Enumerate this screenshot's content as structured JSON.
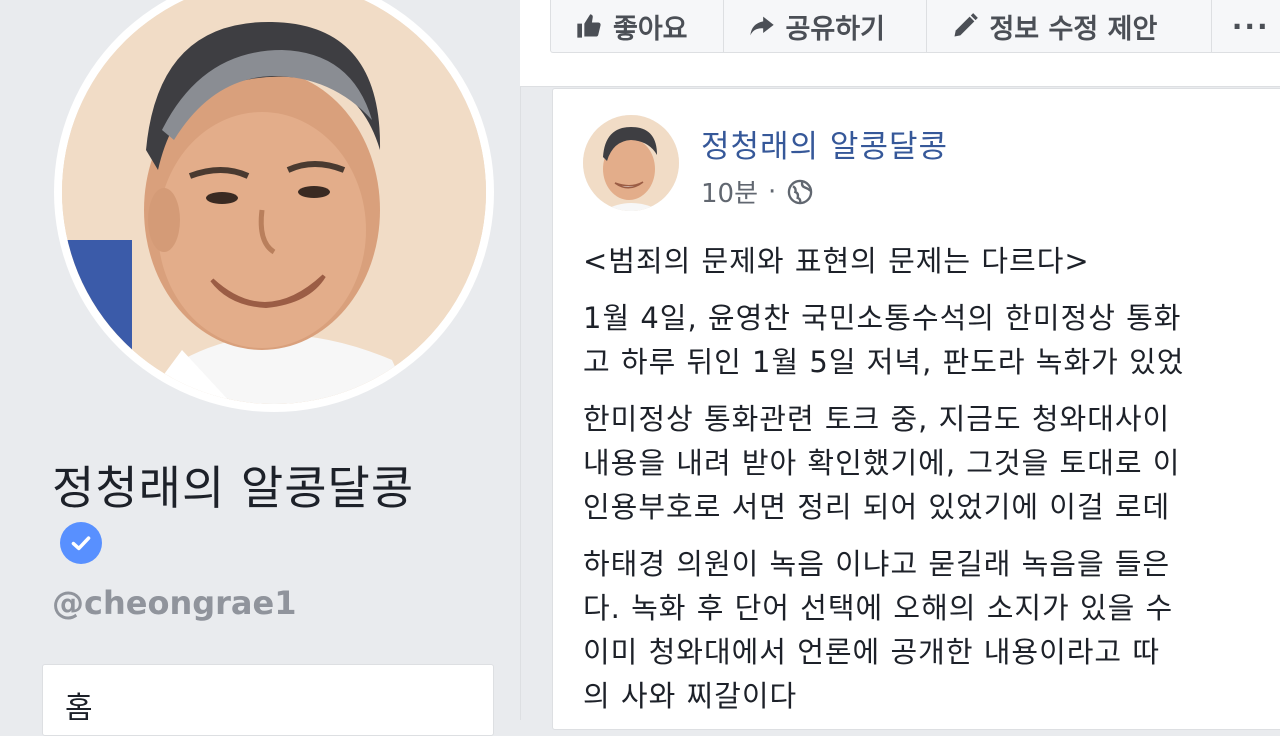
{
  "profile": {
    "name": "정청래의 알콩달콩",
    "handle": "@cheongrae1",
    "verified": true
  },
  "left_nav": {
    "items": [
      {
        "label": "홈"
      }
    ]
  },
  "actions": {
    "like": "좋아요",
    "share": "공유하기",
    "suggest_edit": "정보 수정 제안",
    "more": "···"
  },
  "post": {
    "author": "정청래의 알콩달콩",
    "time": "10분",
    "separator": "·",
    "privacy_icon": "globe-icon",
    "lines": [
      [
        "<범죄의 문제와 표현의 문제는 다르다>"
      ],
      [
        "1월 4일, 윤영찬 국민소통수석의 한미정상 통화",
        "고 하루 뒤인 1월 5일 저녁, 판도라 녹화가 있었"
      ],
      [
        "한미정상 통화관련 토크 중, 지금도 청와대사이",
        "내용을 내려 받아 확인했기에, 그것을 토대로 이",
        "인용부호로 서면 정리 되어 있었기에 이걸 로데"
      ],
      [
        "하태경 의원이 녹음 이냐고 묻길래 녹음을 들은",
        "다. 녹화 후 단어 선택에 오해의 소지가 있을 수",
        "이미 청와대에서 언론에 공개한 내용이라고 따",
        "의 사와 찌갈이다"
      ]
    ]
  },
  "colors": {
    "background": "#e9ebee",
    "link_blue": "#365899",
    "verified_blue": "#5890ff",
    "muted_text": "#90949c"
  }
}
